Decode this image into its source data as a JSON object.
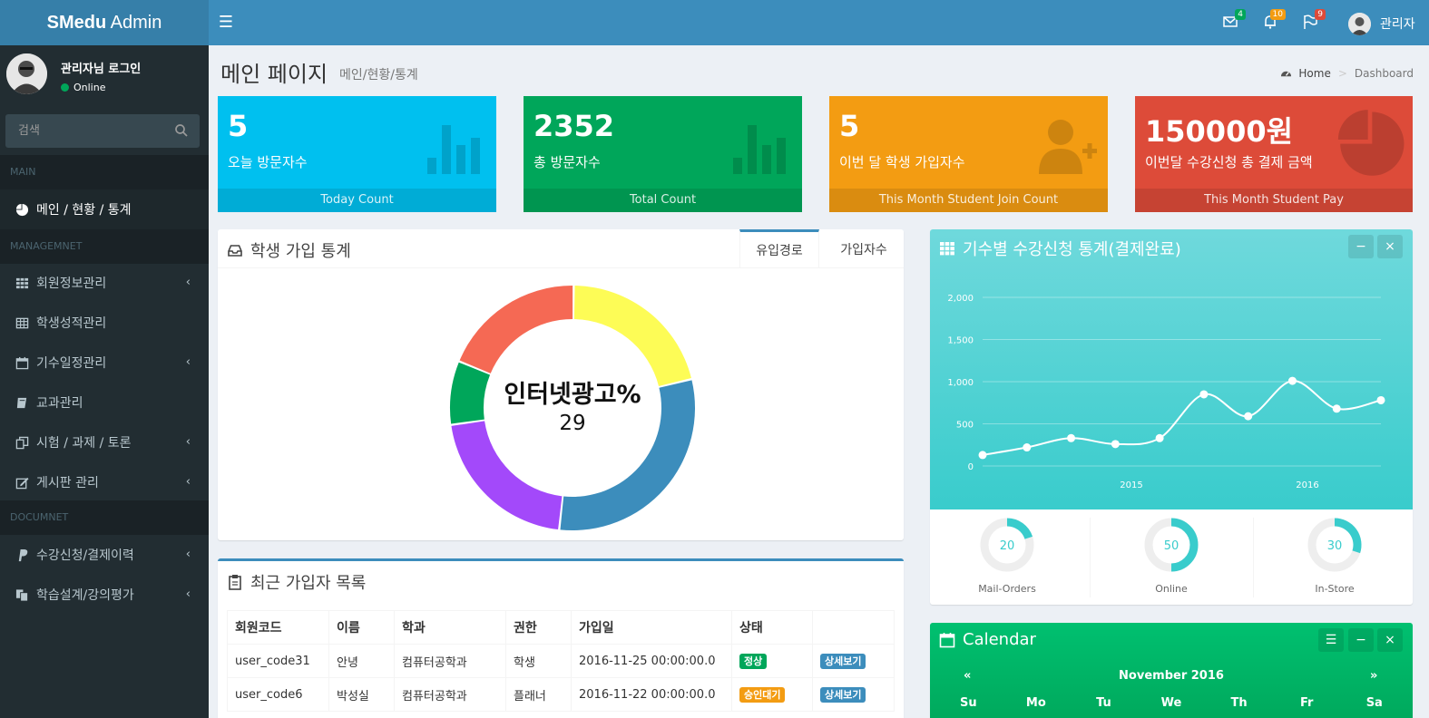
{
  "app": {
    "logo_bold": "SMedu",
    "logo_light": " Admin"
  },
  "header": {
    "mail_count": "4",
    "bell_count": "10",
    "flag_count": "9",
    "user_name": "관리자",
    "colors": {
      "header": "#3c8dbc",
      "logo": "#367fa9"
    }
  },
  "sidebar": {
    "user_title": "관리자님 로그인",
    "user_status": "Online",
    "search_placeholder": "검색",
    "sections": {
      "main": "MAIN",
      "management": "MANAGEMNET",
      "document": "DOCUMNET"
    },
    "items": [
      {
        "label": "메인 / 현황 / 통계",
        "icon": "pie-chart-icon"
      },
      {
        "label": "회원정보관리",
        "icon": "grid-icon"
      },
      {
        "label": "학생성적관리",
        "icon": "table-icon"
      },
      {
        "label": "기수일정관리",
        "icon": "calendar-icon"
      },
      {
        "label": "교과관리",
        "icon": "book-icon"
      },
      {
        "label": "시험 / 과제 / 토론",
        "icon": "copy-icon"
      },
      {
        "label": "게시판 관리",
        "icon": "edit-icon"
      },
      {
        "label": "수강신청/결제이력",
        "icon": "paypal-icon"
      },
      {
        "label": "학습설계/강의평가",
        "icon": "files-icon"
      }
    ]
  },
  "page": {
    "title": "메인 페이지",
    "subtitle": "메인/현황/통계",
    "breadcrumb_home": "Home",
    "breadcrumb_current": "Dashboard"
  },
  "stats": [
    {
      "value": "5",
      "label": "오늘 방문자수",
      "footer": "Today Count",
      "color": "#00c0ef"
    },
    {
      "value": "2352",
      "label": "총 방문자수",
      "footer": "Total Count",
      "color": "#00a65a"
    },
    {
      "value": "5",
      "label": "이번 달 학생 가입자수",
      "footer": "This Month Student Join Count",
      "color": "#f39c12"
    },
    {
      "value": "150000원",
      "label": "이번달 수강신청 총 결제 금액",
      "footer": "This Month Student Pay",
      "color": "#dd4b39"
    }
  ],
  "signup_box": {
    "title": "학생 가입 통계",
    "tabs": [
      "유입경로",
      "가입자수"
    ],
    "center_label": "인터넷광고%",
    "center_value": "29"
  },
  "donut": {
    "segments": [
      {
        "name": "yellow",
        "value": 20,
        "color": "#fdfc56"
      },
      {
        "name": "blue",
        "value": 29,
        "color": "#3c8dbc"
      },
      {
        "name": "purple",
        "value": 20,
        "color": "#a349fa"
      },
      {
        "name": "green",
        "value": 8,
        "color": "#00a65a"
      },
      {
        "name": "red",
        "value": 18,
        "color": "#f56954"
      }
    ]
  },
  "recent_box": {
    "title": "최근 가입자 목록",
    "columns": [
      "회원코드",
      "이름",
      "학과",
      "권한",
      "가입일",
      "상태",
      ""
    ],
    "rows": [
      {
        "code": "user_code31",
        "name": "안녕",
        "dept": "컴퓨터공학과",
        "role": "학생",
        "date": "2016-11-25 00:00:00.0",
        "status": "정상",
        "status_color": "#00a65a",
        "action": "상세보기"
      },
      {
        "code": "user_code6",
        "name": "박성실",
        "dept": "컴퓨터공학과",
        "role": "플래너",
        "date": "2016-11-22 00:00:00.0",
        "status": "승인대기",
        "status_color": "#f39c12",
        "action": "상세보기"
      }
    ]
  },
  "course_box": {
    "title": "기수별 수강신청 통계(결제완료)",
    "min_btn": "−",
    "close_btn": "×",
    "knobs": [
      {
        "value": 20,
        "label": "Mail-Orders"
      },
      {
        "value": 50,
        "label": "Online"
      },
      {
        "value": 30,
        "label": "In-Store"
      }
    ]
  },
  "chart_data": {
    "type": "line",
    "y_ticks": [
      "2,000",
      "1,500",
      "1,000",
      "500",
      "0"
    ],
    "x_ticks": [
      "2015",
      "2016"
    ],
    "ylim": [
      0,
      2000
    ],
    "values": [
      130,
      220,
      330,
      260,
      330,
      850,
      590,
      1010,
      680,
      780
    ],
    "grid": true,
    "color": "#ffffff"
  },
  "calendar_box": {
    "title": "Calendar",
    "prev": "«",
    "next": "»",
    "month": "November 2016",
    "weekdays": [
      "Su",
      "Mo",
      "Tu",
      "We",
      "Th",
      "Fr",
      "Sa"
    ]
  }
}
